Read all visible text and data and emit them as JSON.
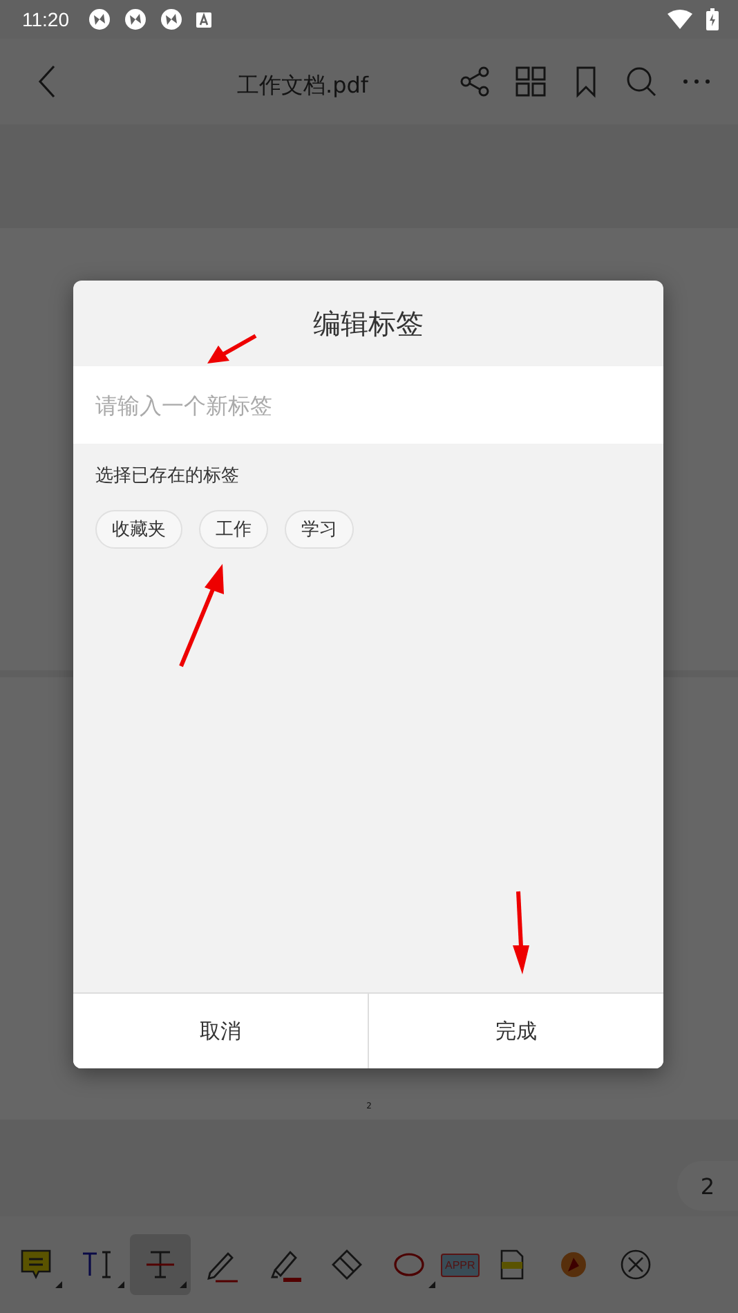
{
  "status_bar": {
    "time": "11:20"
  },
  "header": {
    "title": "工作文档.pdf"
  },
  "document": {
    "page_footer": "2",
    "page_badge": "2"
  },
  "toolbar": {
    "tools": [
      {
        "kind": "note",
        "selected": false,
        "dropdown": true
      },
      {
        "kind": "text",
        "selected": false,
        "dropdown": true
      },
      {
        "kind": "strike",
        "selected": true,
        "dropdown": true
      },
      {
        "kind": "pencil",
        "selected": false,
        "dropdown": false
      },
      {
        "kind": "highlighter",
        "selected": false,
        "dropdown": false
      },
      {
        "kind": "eraser",
        "selected": false,
        "dropdown": false
      },
      {
        "kind": "ellipse",
        "selected": false,
        "dropdown": true
      },
      {
        "kind": "stamp",
        "selected": false,
        "dropdown": false,
        "label": "APPR"
      },
      {
        "kind": "signature",
        "selected": false,
        "dropdown": false
      },
      {
        "kind": "image",
        "selected": false,
        "dropdown": false
      },
      {
        "kind": "close",
        "selected": false,
        "dropdown": false
      }
    ]
  },
  "dialog": {
    "title": "编辑标签",
    "input": {
      "placeholder": "请输入一个新标签"
    },
    "section_label": "选择已存在的标签",
    "tags": [
      {
        "label": "收藏夹"
      },
      {
        "label": "工作"
      },
      {
        "label": "学习"
      }
    ],
    "buttons": [
      {
        "label": "取消"
      },
      {
        "label": "完成"
      }
    ]
  }
}
